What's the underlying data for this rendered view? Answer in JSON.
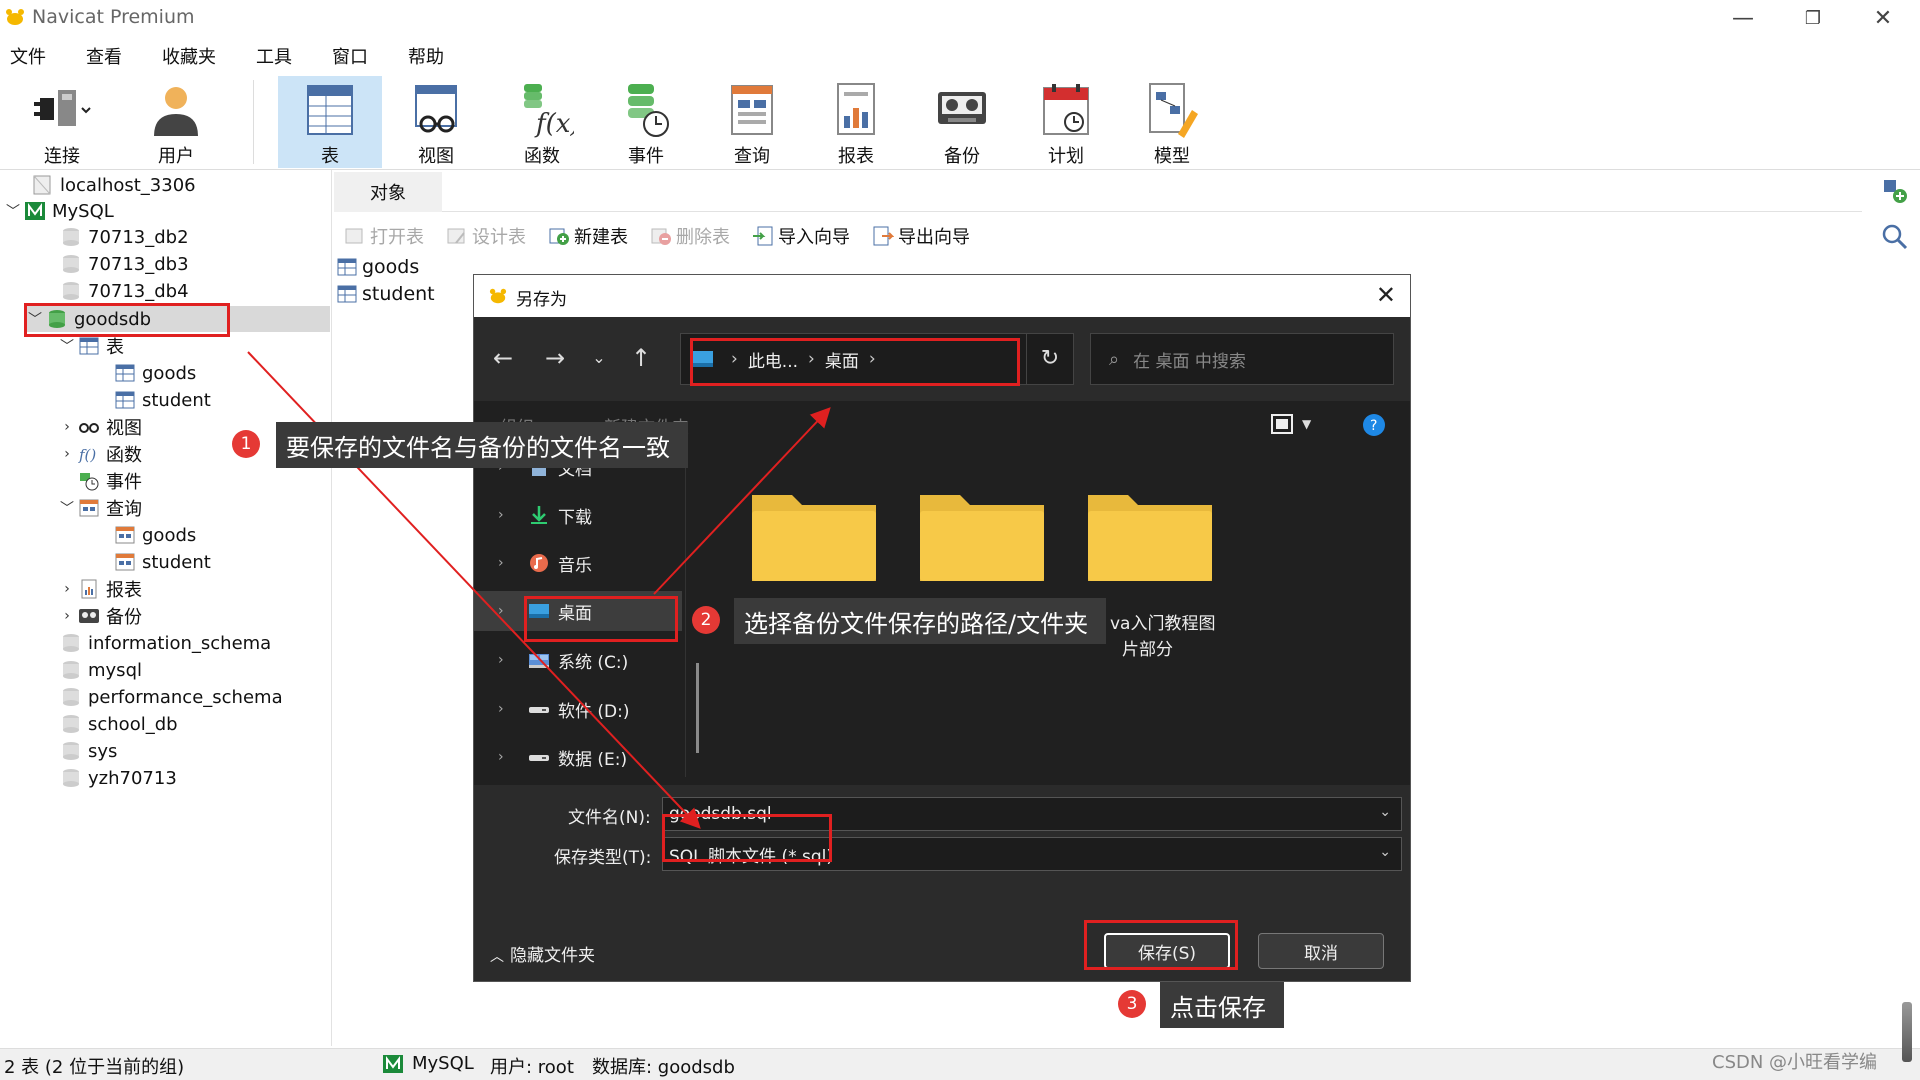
{
  "app": {
    "title": "Navicat Premium",
    "window_controls": {
      "minimize": "—",
      "restore": "❐",
      "close": "✕"
    }
  },
  "menu": [
    "文件",
    "查看",
    "收藏夹",
    "工具",
    "窗口",
    "帮助"
  ],
  "toolbar": {
    "connect": "连接",
    "user": "用户",
    "table": "表",
    "view": "视图",
    "function": "函数",
    "event": "事件",
    "query": "查询",
    "report": "报表",
    "backup": "备份",
    "schedule": "计划",
    "model": "模型"
  },
  "tree": {
    "connection": "localhost_3306",
    "server": "MySQL",
    "databases_top": [
      "70713_db2",
      "70713_db3",
      "70713_db4"
    ],
    "selected_db": "goodsdb",
    "tables_label": "表",
    "tables": [
      "goods",
      "student"
    ],
    "views_label": "视图",
    "functions_label": "函数",
    "events_label": "事件",
    "queries_label": "查询",
    "queries": [
      "goods",
      "student"
    ],
    "reports_label": "报表",
    "backups_label": "备份",
    "databases_bottom": [
      "information_schema",
      "mysql",
      "performance_schema",
      "school_db",
      "sys",
      "yzh70713"
    ]
  },
  "objects": {
    "tab": "对象",
    "tools": {
      "open": "打开表",
      "design": "设计表",
      "new": "新建表",
      "delete": "删除表",
      "import": "导入向导",
      "export": "导出向导"
    },
    "list": [
      "goods",
      "student"
    ]
  },
  "dialog": {
    "title": "另存为",
    "address": {
      "root": "此电...",
      "current": "桌面"
    },
    "search_placeholder": "在 桌面 中搜索",
    "cmd": {
      "organize": "组织 ▾",
      "new_folder": "新建文件夹"
    },
    "nav": {
      "documents": "文档",
      "downloads": "下载",
      "music": "音乐",
      "desktop": "桌面",
      "drive_c": "系统 (C:)",
      "drive_d": "软件 (D:)",
      "drive_e": "数据 (E:)"
    },
    "folder_label_partial": "va入门教程图",
    "folder_label_line2": "片部分",
    "filename_label": "文件名(N):",
    "filename_value": "goodsdb.sql",
    "filetype_label": "保存类型(T):",
    "filetype_value": "SQL 脚本文件 (*.sql)",
    "hide_folders": "隐藏文件夹",
    "save_button": "保存(S)",
    "cancel_button": "取消"
  },
  "annotations": {
    "n1": "1",
    "c1": "要保存的文件名与备份的文件名一致",
    "n2": "2",
    "c2": "选择备份文件保存的路径/文件夹",
    "n3": "3",
    "c3": "点击保存"
  },
  "status": {
    "tables": "2 表 (2 位于当前的组)",
    "server": "MySQL",
    "user": "用户: root",
    "database": "数据库: goodsdb"
  },
  "watermark": "CSDN @小旺看学编",
  "colors": {
    "annotation_red": "#e02020",
    "folder_yellow": "#f7c948",
    "dialog_dark": "#202020",
    "selection_blue": "#cce4f7"
  }
}
